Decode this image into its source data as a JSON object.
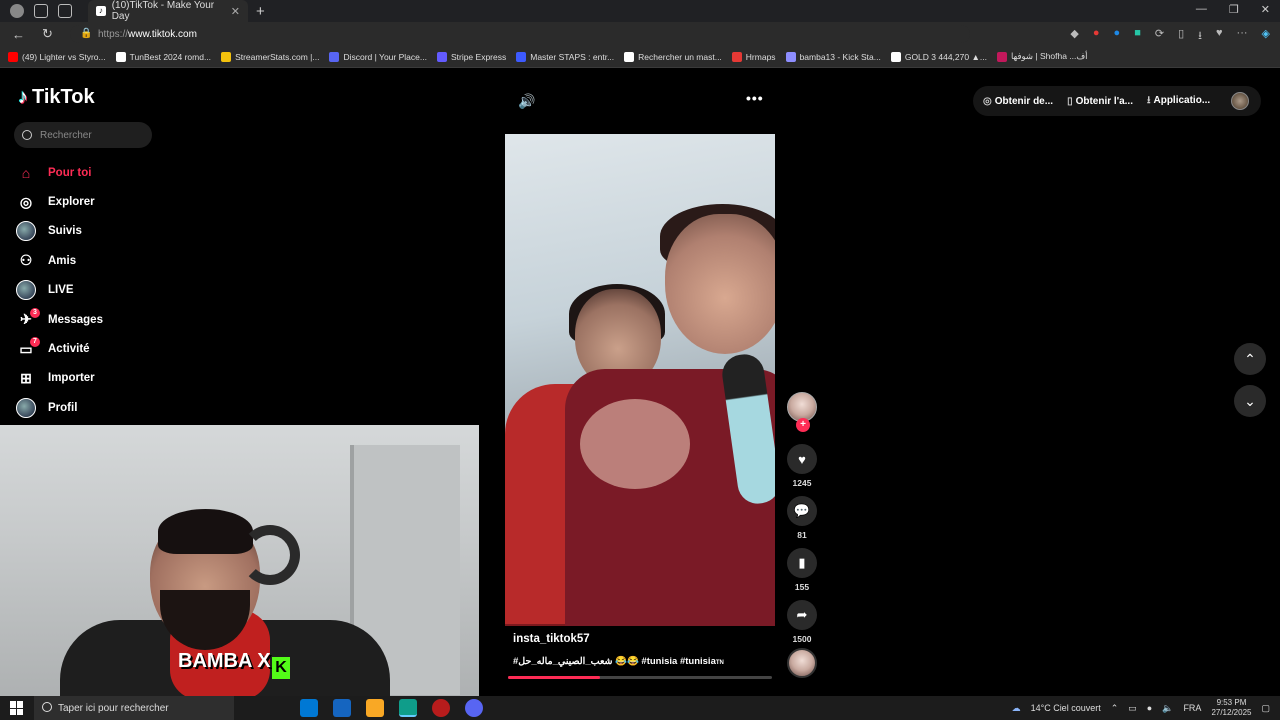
{
  "browser": {
    "tab_title": "(10)TikTok - Make Your Day",
    "url_protocol": "https://",
    "url_host": "www.tiktok.com",
    "bookmarks": [
      {
        "label": "(49) Lighter vs Styro...",
        "color": "#ff0000"
      },
      {
        "label": "TunBest 2024 romd...",
        "color": "#ffffff"
      },
      {
        "label": "StreamerStats.com |...",
        "color": "#f4c20d"
      },
      {
        "label": "Discord | Your Place...",
        "color": "#5865f2"
      },
      {
        "label": "Stripe Express",
        "color": "#635bff"
      },
      {
        "label": "Master STAPS : entr...",
        "color": "#3d5afe"
      },
      {
        "label": "Rechercher un mast...",
        "color": "#ffffff"
      },
      {
        "label": "Hrmaps",
        "color": "#e53935"
      },
      {
        "label": "bamba13 - Kick Sta...",
        "color": "#8e8eff"
      },
      {
        "label": "GOLD 3 444,270 ▲...",
        "color": "#ffffff"
      },
      {
        "label": "شوفها | Shofha ...أف",
        "color": "#c2185b"
      }
    ]
  },
  "tiktok": {
    "logo_text": "TikTok",
    "search_placeholder": "Rechercher",
    "menu": [
      {
        "label": "Pour toi",
        "icon": "home-icon",
        "glyph": "⌂"
      },
      {
        "label": "Explorer",
        "icon": "compass-icon",
        "glyph": "◎"
      },
      {
        "label": "Suivis",
        "icon": "following-avatar-icon",
        "glyph": ""
      },
      {
        "label": "Amis",
        "icon": "friends-icon",
        "glyph": "⚇"
      },
      {
        "label": "LIVE",
        "icon": "live-avatar-icon",
        "glyph": ""
      },
      {
        "label": "Messages",
        "icon": "messages-icon",
        "glyph": "✈",
        "badge": "3"
      },
      {
        "label": "Activité",
        "icon": "activity-icon",
        "glyph": "▭",
        "badge": "7"
      },
      {
        "label": "Importer",
        "icon": "upload-icon",
        "glyph": "⊞"
      },
      {
        "label": "Profil",
        "icon": "profile-avatar-icon",
        "glyph": ""
      }
    ],
    "top_buttons": {
      "coins": "Obtenir de...",
      "app": "Obtenir l'a...",
      "download": "Applicatio..."
    },
    "video": {
      "author": "insta_tiktok57",
      "description": "#شعب_الصيني_ماله_حل 😂😂 #tunisia #tunisia",
      "description_suffix": "TN",
      "progress_percent": 35
    },
    "stats": {
      "likes": "1245",
      "comments": "81",
      "saves": "155",
      "shares": "1500"
    }
  },
  "taskbar": {
    "search_placeholder": "Taper ici pour rechercher",
    "weather": "14°C  Ciel couvert",
    "lang": "FRA",
    "time": "9:53 PM",
    "date": "27/12/2025"
  },
  "webcam": {
    "logo_text": "BAMBA X",
    "k_letter": "K"
  }
}
